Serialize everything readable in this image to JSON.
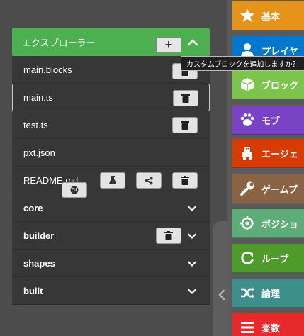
{
  "explorer": {
    "title": "エクスプローラー",
    "add_label": "+",
    "tooltip": "カスタムブロックを追加しますか？",
    "files": [
      {
        "name": "main.blocks"
      },
      {
        "name": "main.ts"
      },
      {
        "name": "test.ts"
      },
      {
        "name": "pxt.json"
      },
      {
        "name": "README.md"
      }
    ],
    "folders": [
      {
        "name": "core"
      },
      {
        "name": "builder"
      },
      {
        "name": "shapes"
      },
      {
        "name": "built"
      }
    ]
  },
  "toolbox": {
    "categories": [
      {
        "label": "基本",
        "color": "#e6931a",
        "icon": "star-icon"
      },
      {
        "label": "プレイヤ",
        "color": "#0077cc",
        "icon": "person-icon"
      },
      {
        "label": "ブロック",
        "color": "#7cc44b",
        "icon": "cube-icon"
      },
      {
        "label": "モブ",
        "color": "#7a43c6",
        "icon": "paw-icon"
      },
      {
        "label": "エージェ",
        "color": "#d83b01",
        "icon": "agent-icon"
      },
      {
        "label": "ゲームプ",
        "color": "#8a6244",
        "icon": "wrench-icon"
      },
      {
        "label": "ポジショ",
        "color": "#5ead78",
        "icon": "crosshair-icon"
      },
      {
        "label": "ループ",
        "color": "#4e9a2a",
        "icon": "loop-icon"
      },
      {
        "label": "論理",
        "color": "#3e8e8c",
        "icon": "shuffle-icon"
      },
      {
        "label": "変数",
        "color": "#e8292b",
        "icon": "list-icon"
      }
    ]
  },
  "colors": {
    "accent": "#4caf50",
    "background": "#4c4c4c",
    "row": "#373737"
  }
}
